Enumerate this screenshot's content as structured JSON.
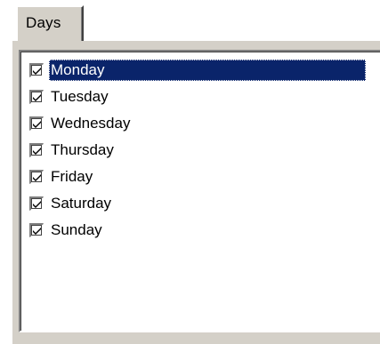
{
  "tab": {
    "label": "Days"
  },
  "list": {
    "items": [
      {
        "label": "Monday",
        "checked": true,
        "selected": true
      },
      {
        "label": "Tuesday",
        "checked": true,
        "selected": false
      },
      {
        "label": "Wednesday",
        "checked": true,
        "selected": false
      },
      {
        "label": "Thursday",
        "checked": true,
        "selected": false
      },
      {
        "label": "Friday",
        "checked": true,
        "selected": false
      },
      {
        "label": "Saturday",
        "checked": true,
        "selected": false
      },
      {
        "label": "Sunday",
        "checked": true,
        "selected": false
      }
    ]
  },
  "colors": {
    "face": "#d4d0c8",
    "selection": "#0a246a",
    "window": "#ffffff"
  }
}
